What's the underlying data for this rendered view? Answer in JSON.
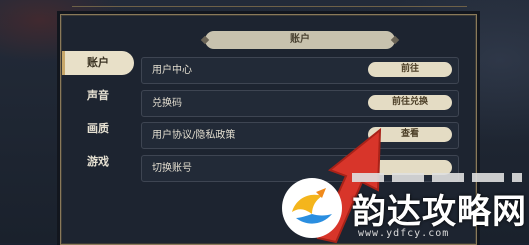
{
  "header": {
    "title": "账户"
  },
  "sidebar": {
    "items": [
      {
        "label": "账户",
        "active": true
      },
      {
        "label": "声音",
        "active": false
      },
      {
        "label": "画质",
        "active": false
      },
      {
        "label": "游戏",
        "active": false
      }
    ]
  },
  "account": {
    "rows": [
      {
        "label": "用户中心",
        "button": "前往"
      },
      {
        "label": "兑换码",
        "button": "前往兑换"
      },
      {
        "label": "用户协议/隐私政策",
        "button": "查看"
      },
      {
        "label": "切换账号",
        "button": ""
      }
    ]
  },
  "watermark": {
    "title": "韵达攻略网",
    "url": "www.ydfcy.com"
  },
  "colors": {
    "accent": "#e4dcc4",
    "arrow": "#d8352a",
    "panel_border": "#8a7a5a"
  }
}
